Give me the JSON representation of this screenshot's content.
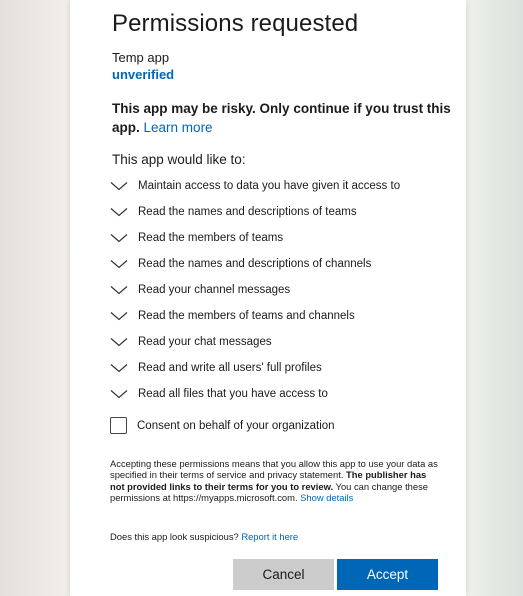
{
  "dialog": {
    "title": "Permissions requested",
    "app_name": "Temp app",
    "verification_status": "unverified",
    "risk_warning": "This app may be risky. Only continue if you trust this app.",
    "learn_more_link": "Learn more",
    "intro": "This app would like to:",
    "permissions": [
      "Maintain access to data you have given it access to",
      "Read the names and descriptions of teams",
      "Read the members of teams",
      "Read the names and descriptions of channels",
      "Read your channel messages",
      "Read the members of teams and channels",
      "Read your chat messages",
      "Read and write all users' full profiles",
      "Read all files that you have access to"
    ],
    "consent_label": "Consent on behalf of your organization",
    "consent_checked": false,
    "disclaimer_part1": "Accepting these permissions means that you allow this app to use your data as specified in their terms of service and privacy statement.",
    "disclaimer_bold": "The publisher has not provided links to their terms for you to review.",
    "disclaimer_part2": "You can change these permissions at https://myapps.microsoft.com.",
    "show_details_link": "Show details",
    "suspicious_text": "Does this app look suspicious?",
    "report_link": "Report it here",
    "cancel_label": "Cancel",
    "accept_label": "Accept"
  },
  "colors": {
    "accent": "#0067b8",
    "cancel_button": "#cccccc",
    "text": "#1b1b1b"
  }
}
